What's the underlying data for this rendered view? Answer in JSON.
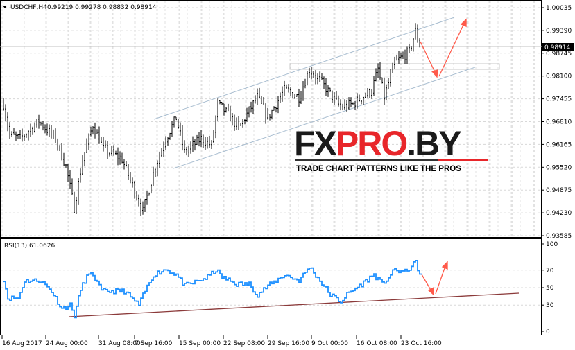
{
  "header": {
    "symbol": "USDCHF,H4",
    "values": "0.99219 0.99278 0.98832 0.98914",
    "dropdown_icon": "triangle-down-icon"
  },
  "price_axis": {
    "ticks": [
      "1.00035",
      "0.99390",
      "0.98745",
      "0.98100",
      "0.97455",
      "0.96810",
      "0.96165",
      "0.95520",
      "0.94875",
      "0.94230",
      "0.93585"
    ],
    "last_price": "0.98914"
  },
  "rsi": {
    "label": "RSI(13) 61.0626",
    "ticks": [
      "100",
      "70",
      "50",
      "30",
      "0"
    ]
  },
  "time_axis": [
    "16 Aug 2017",
    "24 Aug 00:00",
    "31 Aug 08:00",
    "7 Sep 16:00",
    "15 Sep 00:00",
    "22 Sep 08:00",
    "29 Sep 16:00",
    "9 Oct 00:00",
    "16 Oct 08:00",
    "23 Oct 16:00"
  ],
  "watermark": {
    "brand": "FXPRO.BY",
    "brand_a": "FX",
    "brand_b": "PRO",
    "brand_c": ".BY",
    "tagline": "TRADE CHART PATTERNS LIKE THE PROS"
  },
  "colors": {
    "rsi_line": "#1e90ff",
    "arrow": "#ff5a4a",
    "channel": "#a8bdd0",
    "rsi_trend": "#8b3a3a",
    "grid": "#d0d0d0"
  },
  "chart_data": {
    "type": "ohlc",
    "price_range": [
      0.93585,
      1.00035
    ],
    "price_path": [
      [
        0,
        0.97311
      ],
      [
        3,
        0.96429
      ],
      [
        8,
        0.96331
      ],
      [
        17,
        0.96821
      ],
      [
        25,
        0.96331
      ],
      [
        30,
        0.95547
      ],
      [
        34,
        0.94371
      ],
      [
        38,
        0.95743
      ],
      [
        43,
        0.96723
      ],
      [
        48,
        0.96037
      ],
      [
        57,
        0.95743
      ],
      [
        65,
        0.94567
      ],
      [
        67,
        0.94273
      ],
      [
        73,
        0.95547
      ],
      [
        78,
        0.96331
      ],
      [
        83,
        0.96919
      ],
      [
        87,
        0.95939
      ],
      [
        95,
        0.96331
      ],
      [
        100,
        0.96135
      ],
      [
        103,
        0.97311
      ],
      [
        108,
        0.97017
      ],
      [
        113,
        0.96625
      ],
      [
        122,
        0.97507
      ],
      [
        127,
        0.96919
      ],
      [
        135,
        0.97703
      ],
      [
        142,
        0.97507
      ],
      [
        147,
        0.98291
      ],
      [
        153,
        0.97899
      ],
      [
        162,
        0.97213
      ],
      [
        168,
        0.97311
      ],
      [
        177,
        0.97703
      ],
      [
        180,
        0.98291
      ],
      [
        183,
        0.97507
      ],
      [
        188,
        0.98487
      ],
      [
        195,
        0.98781
      ],
      [
        198,
        0.99369
      ],
      [
        200,
        0.98977
      ]
    ],
    "rsi_range": [
      0,
      100
    ],
    "rsi_path": [
      [
        0,
        60
      ],
      [
        2,
        38
      ],
      [
        7,
        38
      ],
      [
        10,
        58
      ],
      [
        18,
        58
      ],
      [
        23,
        46
      ],
      [
        28,
        26
      ],
      [
        32,
        30
      ],
      [
        34,
        18
      ],
      [
        37,
        48
      ],
      [
        40,
        63
      ],
      [
        43,
        65
      ],
      [
        47,
        46
      ],
      [
        52,
        46
      ],
      [
        58,
        46
      ],
      [
        65,
        30
      ],
      [
        68,
        46
      ],
      [
        72,
        65
      ],
      [
        78,
        71
      ],
      [
        83,
        65
      ],
      [
        87,
        52
      ],
      [
        92,
        56
      ],
      [
        98,
        62
      ],
      [
        102,
        70
      ],
      [
        105,
        62
      ],
      [
        112,
        54
      ],
      [
        118,
        54
      ],
      [
        122,
        42
      ],
      [
        127,
        52
      ],
      [
        130,
        56
      ],
      [
        135,
        65
      ],
      [
        142,
        58
      ],
      [
        147,
        74
      ],
      [
        152,
        58
      ],
      [
        157,
        42
      ],
      [
        162,
        34
      ],
      [
        165,
        42
      ],
      [
        172,
        54
      ],
      [
        178,
        65
      ],
      [
        182,
        54
      ],
      [
        185,
        62
      ],
      [
        188,
        70
      ],
      [
        193,
        68
      ],
      [
        198,
        79
      ],
      [
        200,
        65
      ]
    ]
  }
}
